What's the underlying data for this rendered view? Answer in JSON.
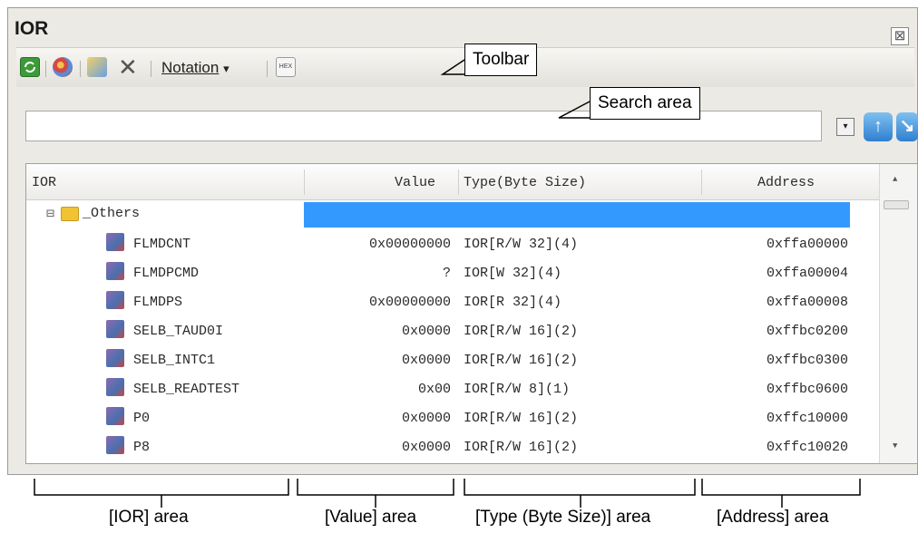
{
  "window": {
    "title": "IOR",
    "close_glyph": "⊠"
  },
  "toolbar": {
    "notation_label": "Notation",
    "notation_dropdown_glyph": "▾",
    "delete_glyph": "✕",
    "items": [
      "refresh-icon",
      "watch-color-icon",
      "register-category-icon",
      "delete-icon",
      "notation-dropdown",
      "hex-output-icon"
    ],
    "hex_icon_text": "HEX"
  },
  "search": {
    "value": "",
    "dropdown_glyph": "▾",
    "prev_glyph": "↑",
    "next_glyph": "↘"
  },
  "grid": {
    "columns": [
      "IOR",
      "Value",
      "Type(Byte Size)",
      "Address"
    ],
    "group": {
      "name": "_Others",
      "expander": "⊟"
    },
    "rows": [
      {
        "ior": "FLMDCNT",
        "value": "0x00000000",
        "type": "IOR[R/W 32](4)",
        "address": "0xffa00000"
      },
      {
        "ior": "FLMDPCMD",
        "value": "?",
        "type": "IOR[W 32](4)",
        "address": "0xffa00004"
      },
      {
        "ior": "FLMDPS",
        "value": "0x00000000",
        "type": "IOR[R 32](4)",
        "address": "0xffa00008"
      },
      {
        "ior": "SELB_TAUD0I",
        "value": "0x0000",
        "type": "IOR[R/W 16](2)",
        "address": "0xffbc0200"
      },
      {
        "ior": "SELB_INTC1",
        "value": "0x0000",
        "type": "IOR[R/W 16](2)",
        "address": "0xffbc0300"
      },
      {
        "ior": "SELB_READTEST",
        "value": "0x00",
        "type": "IOR[R/W 8](1)",
        "address": "0xffbc0600"
      },
      {
        "ior": "P0",
        "value": "0x0000",
        "type": "IOR[R/W 16](2)",
        "address": "0xffc10000"
      },
      {
        "ior": "P8",
        "value": "0x0000",
        "type": "IOR[R/W 16](2)",
        "address": "0xffc10020"
      }
    ],
    "scroll_up": "▲",
    "scroll_down": "▼"
  },
  "callouts": {
    "toolbar": "Toolbar",
    "search_area": "Search area"
  },
  "annotations": {
    "ior_area": "[IOR] area",
    "value_area": "[Value] area",
    "type_area": "[Type (Byte Size)] area",
    "address_area": "[Address] area"
  },
  "colors": {
    "selection": "#3399ff",
    "accent": "#3a8ad8",
    "window_bg": "#eceae4"
  }
}
